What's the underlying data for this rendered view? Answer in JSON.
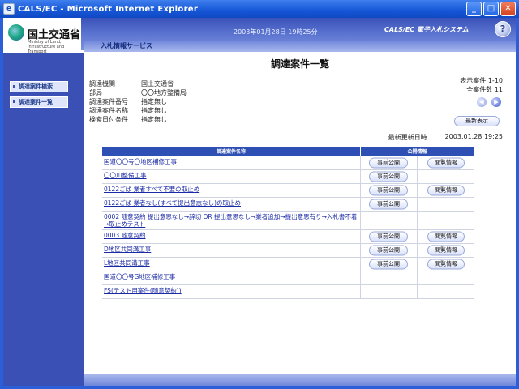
{
  "window": {
    "title": "CALS/EC - Microsoft Internet Explorer",
    "min": "_",
    "max": "□",
    "close": "✕"
  },
  "header": {
    "logo_text": "国土交通省",
    "logo_sub": "Ministry of Land, Infrastructure and Transport",
    "datetime": "2003年01月28日 19時25分",
    "system_name": "CALS/EC 電子入札システム",
    "service_label": "入札情報サービス"
  },
  "sidebar": {
    "items": [
      {
        "label": "調達案件検索"
      },
      {
        "label": "調達案件一覧"
      }
    ]
  },
  "main": {
    "title": "調達案件一覧",
    "conditions": [
      {
        "key": "調達機関",
        "value": "国土交通省"
      },
      {
        "key": "部局",
        "value": "〇〇地方整備局"
      },
      {
        "key": "調達案件番号",
        "value": "指定無し"
      },
      {
        "key": "調達案件名称",
        "value": "指定無し"
      },
      {
        "key": "検索日付条件",
        "value": "指定無し"
      }
    ],
    "paging": {
      "display": "表示案件 1-10",
      "total": "全案件数 11"
    },
    "refresh_label": "最新表示",
    "updated_label": "最新更新日時",
    "updated_value": "2003.01.28 19:25",
    "table": {
      "col_name": "調達案件名称",
      "col_public": "公開情報",
      "rows": [
        {
          "name": "国道〇〇号〇地区補修工事",
          "a": "事前公開",
          "b": "閲覧情報"
        },
        {
          "name": "〇〇川整備工事",
          "a": "事前公開",
          "b": ""
        },
        {
          "name": "0122ごば 業者すべて不要の取止め",
          "a": "事前公開",
          "b": "閲覧情報"
        },
        {
          "name": "0122ごば 業者なし(すべて提出意志なし)の取止め",
          "a": "事前公開",
          "b": ""
        },
        {
          "name": "0002 随意契約 提出意思なし→辞切 OR 提出意思なし→業者追加→提出意思有り→入札書不着→取止めテスト",
          "a": "",
          "b": ""
        },
        {
          "name": "0003 随意契約",
          "a": "事前公開",
          "b": "閲覧情報"
        },
        {
          "name": "D地区共同溝工事",
          "a": "事前公開",
          "b": "閲覧情報"
        },
        {
          "name": "L地区共同溝工事",
          "a": "事前公開",
          "b": "閲覧情報"
        },
        {
          "name": "国道〇〇号G地区補修工事",
          "a": "",
          "b": ""
        },
        {
          "name": "FS(テスト用案件(随意契約))",
          "a": "",
          "b": ""
        }
      ]
    }
  }
}
